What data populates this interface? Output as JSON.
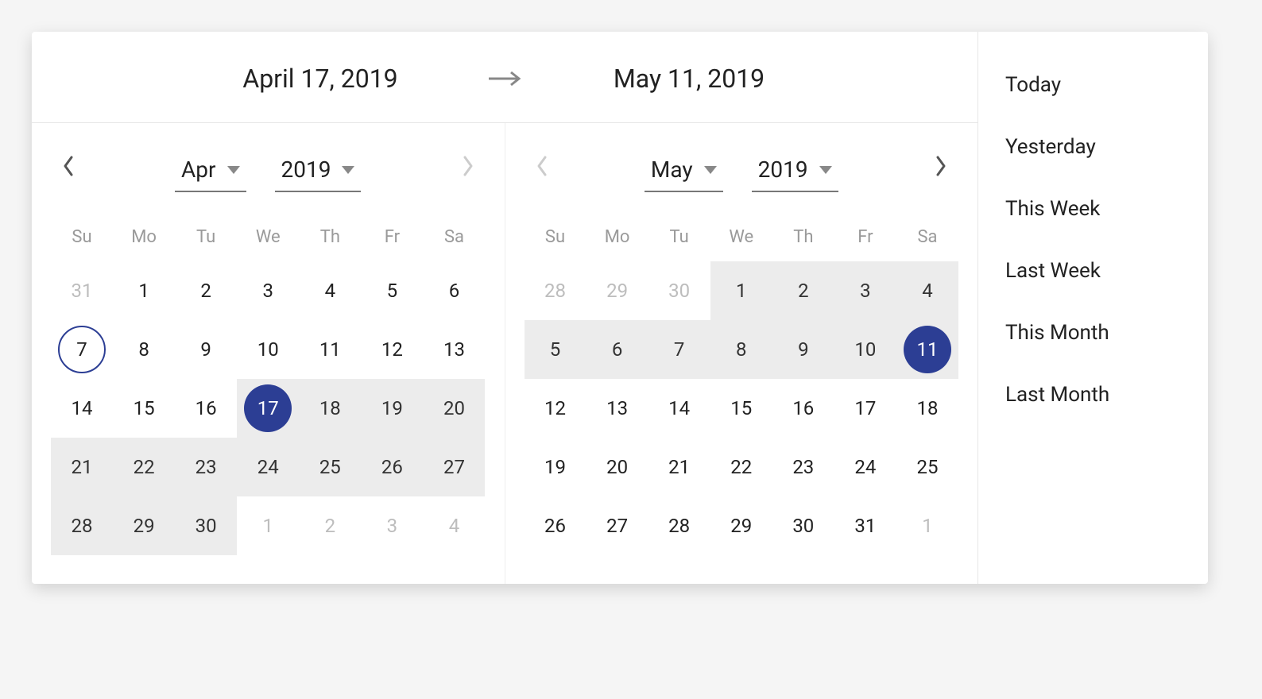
{
  "header": {
    "start_label": "April 17, 2019",
    "end_label": "May 11, 2019"
  },
  "calendars": [
    {
      "month_label": "Apr",
      "year_label": "2019",
      "prev_enabled": true,
      "next_enabled": false,
      "weekdays": [
        "Su",
        "Mo",
        "Tu",
        "We",
        "Th",
        "Fr",
        "Sa"
      ],
      "days": [
        {
          "n": 31,
          "other": true
        },
        {
          "n": 1
        },
        {
          "n": 2
        },
        {
          "n": 3
        },
        {
          "n": 4
        },
        {
          "n": 5
        },
        {
          "n": 6
        },
        {
          "n": 7,
          "today": true
        },
        {
          "n": 8
        },
        {
          "n": 9
        },
        {
          "n": 10
        },
        {
          "n": 11
        },
        {
          "n": 12
        },
        {
          "n": 13
        },
        {
          "n": 14
        },
        {
          "n": 15
        },
        {
          "n": 16
        },
        {
          "n": 17,
          "selected": true,
          "in_range": true
        },
        {
          "n": 18,
          "in_range": true
        },
        {
          "n": 19,
          "in_range": true
        },
        {
          "n": 20,
          "in_range": true
        },
        {
          "n": 21,
          "in_range": true
        },
        {
          "n": 22,
          "in_range": true
        },
        {
          "n": 23,
          "in_range": true
        },
        {
          "n": 24,
          "in_range": true
        },
        {
          "n": 25,
          "in_range": true
        },
        {
          "n": 26,
          "in_range": true
        },
        {
          "n": 27,
          "in_range": true
        },
        {
          "n": 28,
          "in_range": true
        },
        {
          "n": 29,
          "in_range": true
        },
        {
          "n": 30,
          "in_range": true
        },
        {
          "n": 1,
          "other": true
        },
        {
          "n": 2,
          "other": true
        },
        {
          "n": 3,
          "other": true
        },
        {
          "n": 4,
          "other": true
        }
      ]
    },
    {
      "month_label": "May",
      "year_label": "2019",
      "prev_enabled": false,
      "next_enabled": true,
      "weekdays": [
        "Su",
        "Mo",
        "Tu",
        "We",
        "Th",
        "Fr",
        "Sa"
      ],
      "days": [
        {
          "n": 28,
          "other": true
        },
        {
          "n": 29,
          "other": true
        },
        {
          "n": 30,
          "other": true
        },
        {
          "n": 1,
          "in_range": true
        },
        {
          "n": 2,
          "in_range": true
        },
        {
          "n": 3,
          "in_range": true
        },
        {
          "n": 4,
          "in_range": true
        },
        {
          "n": 5,
          "in_range": true
        },
        {
          "n": 6,
          "in_range": true
        },
        {
          "n": 7,
          "in_range": true
        },
        {
          "n": 8,
          "in_range": true
        },
        {
          "n": 9,
          "in_range": true
        },
        {
          "n": 10,
          "in_range": true
        },
        {
          "n": 11,
          "selected": true,
          "in_range": true
        },
        {
          "n": 12
        },
        {
          "n": 13
        },
        {
          "n": 14
        },
        {
          "n": 15
        },
        {
          "n": 16
        },
        {
          "n": 17
        },
        {
          "n": 18
        },
        {
          "n": 19
        },
        {
          "n": 20
        },
        {
          "n": 21
        },
        {
          "n": 22
        },
        {
          "n": 23
        },
        {
          "n": 24
        },
        {
          "n": 25
        },
        {
          "n": 26
        },
        {
          "n": 27
        },
        {
          "n": 28
        },
        {
          "n": 29
        },
        {
          "n": 30
        },
        {
          "n": 31
        },
        {
          "n": 1,
          "other": true
        }
      ]
    }
  ],
  "presets": [
    "Today",
    "Yesterday",
    "This Week",
    "Last Week",
    "This Month",
    "Last Month"
  ]
}
